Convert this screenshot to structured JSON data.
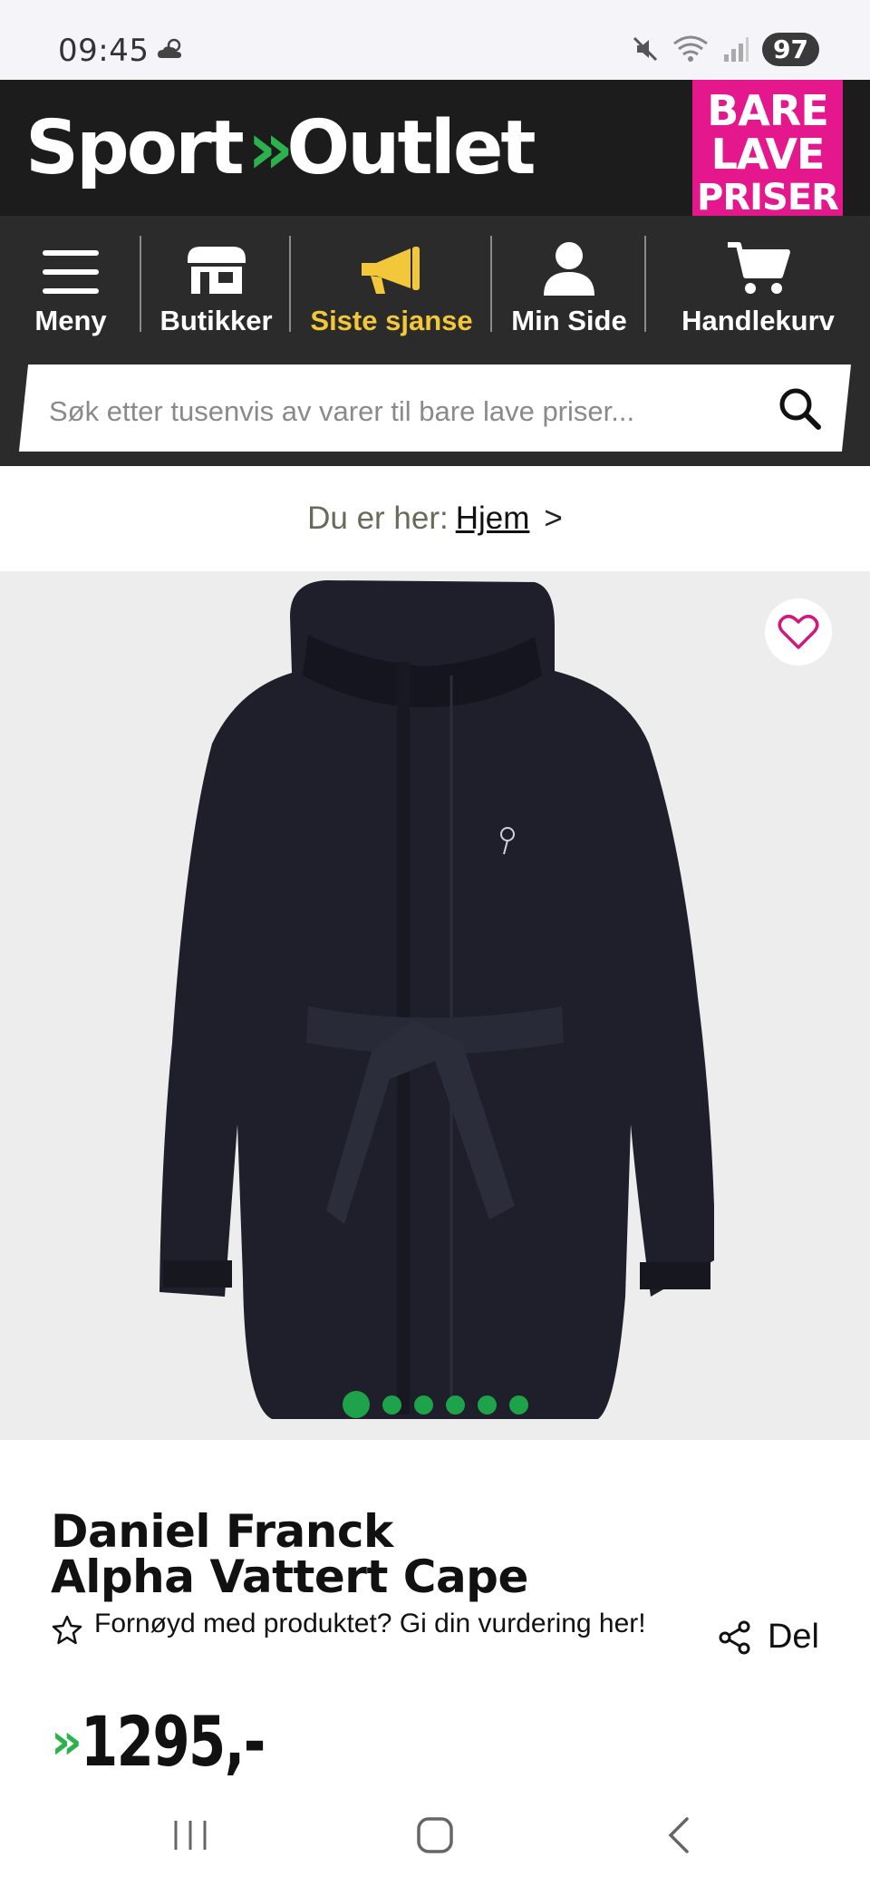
{
  "status_bar": {
    "time": "09:45",
    "battery": "97",
    "icons": [
      "weather-icon",
      "mute-icon",
      "wifi-icon",
      "signal-icon"
    ]
  },
  "header": {
    "logo_left": "Sport",
    "logo_sep": "»",
    "logo_right": "Outlet",
    "promo": [
      "BARE",
      "LAVE",
      "PRISER"
    ]
  },
  "nav": {
    "items": [
      {
        "label": "Meny",
        "icon": "menu-icon"
      },
      {
        "label": "Butikker",
        "icon": "store-icon"
      },
      {
        "label": "Siste sjanse",
        "icon": "megaphone-icon"
      },
      {
        "label": "Min Side",
        "icon": "user-icon"
      },
      {
        "label": "Handlekurv",
        "icon": "cart-icon"
      }
    ],
    "highlight_color": "#f2c73a"
  },
  "search": {
    "placeholder": "Søk etter tusenvis av varer til bare lave priser..."
  },
  "breadcrumb": {
    "prefix": "Du er her:",
    "home": "Hjem",
    "chevron": ">"
  },
  "gallery": {
    "image_count": 6,
    "active_index": 0
  },
  "product": {
    "brand": "Daniel Franck",
    "name": "Alpha Vattert Cape",
    "rating_prompt": "Fornøyd med produktet? Gi din vurdering her!",
    "share_label": "Del",
    "price_arrows": "»",
    "price": "1295,-"
  },
  "colors": {
    "brand_green": "#2bb24c",
    "promo_pink": "#e5178c",
    "header_dark": "#1c1c1c",
    "nav_dark": "#2b2b2b"
  }
}
